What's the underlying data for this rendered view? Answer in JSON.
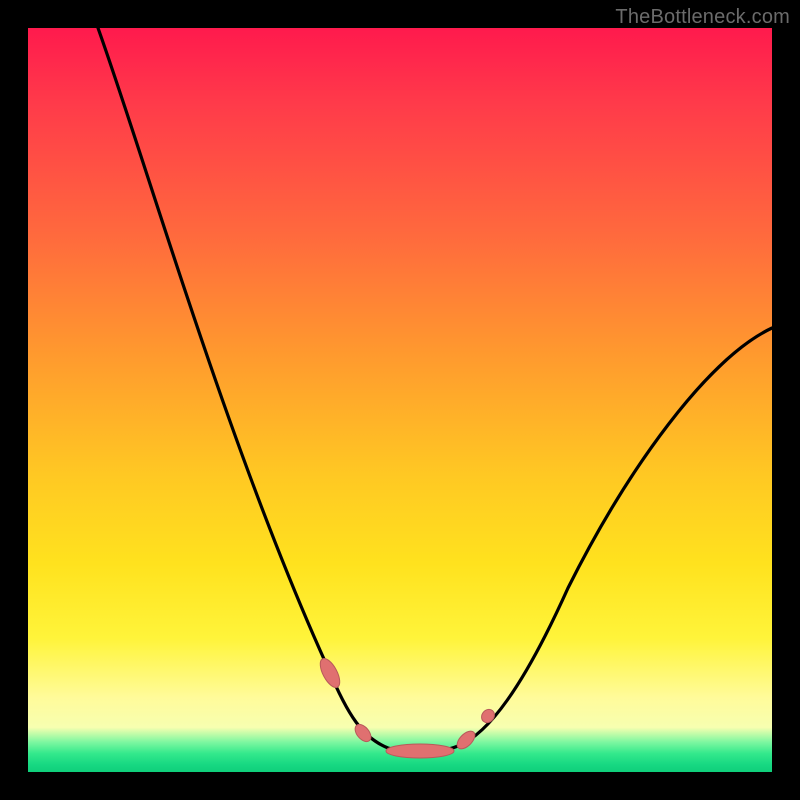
{
  "watermark": {
    "text": "TheBottleneck.com"
  },
  "colors": {
    "page_bg": "#000000",
    "curve": "#000000",
    "marker_fill": "#e07070",
    "marker_stroke": "#b85a5a",
    "gradient_top": "#ff1a4d",
    "gradient_mid": "#ffe21e",
    "gradient_bottom": "#0fcf7b"
  },
  "chart_data": {
    "type": "line",
    "title": "",
    "xlabel": "",
    "ylabel": "",
    "x": [
      0,
      5,
      10,
      15,
      20,
      25,
      30,
      35,
      40,
      42,
      45,
      48,
      50,
      52,
      55,
      58,
      60,
      65,
      70,
      75,
      80,
      85,
      90,
      95,
      100
    ],
    "series": [
      {
        "name": "curve",
        "values": [
          100,
          89,
          78,
          67,
          56,
          45,
          34,
          23,
          12,
          7,
          3,
          1,
          0,
          0,
          1,
          4,
          8,
          17,
          25,
          32,
          38,
          43,
          48,
          52,
          55
        ]
      }
    ],
    "markers": [
      {
        "x": 40,
        "y": 12,
        "shape": "pill",
        "orient": "diag-down"
      },
      {
        "x": 45,
        "y": 3,
        "shape": "pill",
        "orient": "diag-down-short"
      },
      {
        "x": 50,
        "y": 0,
        "shape": "pill",
        "orient": "horiz-long"
      },
      {
        "x": 56,
        "y": 2,
        "shape": "pill",
        "orient": "diag-up-short"
      },
      {
        "x": 59,
        "y": 6,
        "shape": "round",
        "orient": "dot"
      }
    ],
    "xlim": [
      0,
      100
    ],
    "ylim": [
      0,
      100
    ],
    "grid": false,
    "legend": false
  }
}
